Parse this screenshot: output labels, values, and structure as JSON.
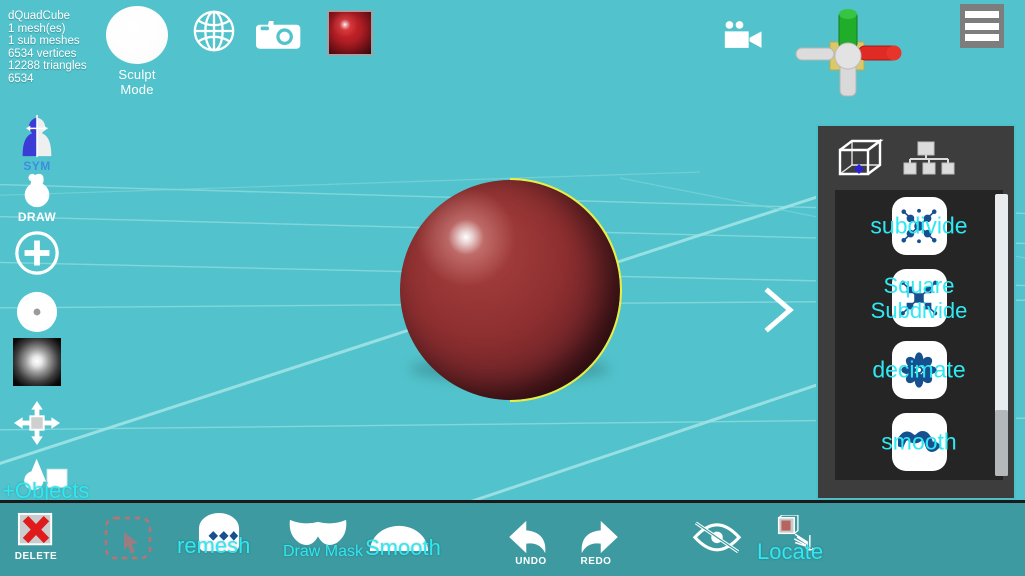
{
  "app": {
    "mode_label": "Sculpt Mode",
    "background_color": "#52c3cc",
    "accent_cyan": "#2ee8f2",
    "panel_color": "#3d3d3d",
    "selection_outline_color": "#f2f03a"
  },
  "mesh_info": {
    "name": "dQuadCube",
    "meshes": "1 mesh(es)",
    "sub_meshes": "1 sub meshes",
    "vertices": "6534 vertices",
    "triangles": "12288 triangles",
    "extra_count": "6534"
  },
  "top_toolbar": {
    "sculpt_mode_label": "Sculpt Mode",
    "globe_icon": "globe-icon",
    "camera_icon": "camera-icon",
    "material_icon": "material-sphere-swatch",
    "video_camera_icon": "video-camera-icon",
    "menu_icon": "hamburger-menu-icon",
    "gizmo_icon": "axis-gizmo"
  },
  "left_toolbar": {
    "items": [
      {
        "name": "symmetry",
        "label": "SYM",
        "icon": "symmetry-icon"
      },
      {
        "name": "draw",
        "label": "DRAW",
        "icon": "draw-brush-icon"
      },
      {
        "name": "radius",
        "label": "",
        "icon": "plus-circle-icon"
      },
      {
        "name": "intensity",
        "label": "",
        "icon": "dot-circle-icon"
      },
      {
        "name": "falloff",
        "label": "",
        "icon": "brush-falloff-texture"
      },
      {
        "name": "transform",
        "label": "",
        "icon": "move-gizmo-icon"
      },
      {
        "name": "objects",
        "label": "+Objects",
        "icon": "primitives-icon"
      }
    ]
  },
  "viewport": {
    "expand_chevron": "chevron-right-icon",
    "object_name": "dQuadCube"
  },
  "right_panel": {
    "tabs": [
      {
        "name": "mesh",
        "icon": "wireframe-cube-icon"
      },
      {
        "name": "hierarchy",
        "icon": "hierarchy-tree-icon"
      }
    ],
    "tools": [
      {
        "label": "subdivide",
        "icon": "subdivide-icon"
      },
      {
        "label": "Square Subdivide",
        "icon": "square-subdivide-icon"
      },
      {
        "label": "decimate",
        "icon": "decimate-icon"
      },
      {
        "label": "smooth",
        "icon": "smooth-wave-icon"
      },
      {
        "label": "",
        "icon": "partial-tool-icon"
      }
    ]
  },
  "bottom_toolbar": {
    "delete_label": "DELETE",
    "undo_label": "UNDO",
    "redo_label": "REDO",
    "remesh_label": "remesh",
    "mask_label": "Draw Mask",
    "smooth_label": "Smooth",
    "locate_label": "Locate",
    "select_icon": "marquee-select-icon",
    "hide_icon": "eye-off-icon"
  }
}
